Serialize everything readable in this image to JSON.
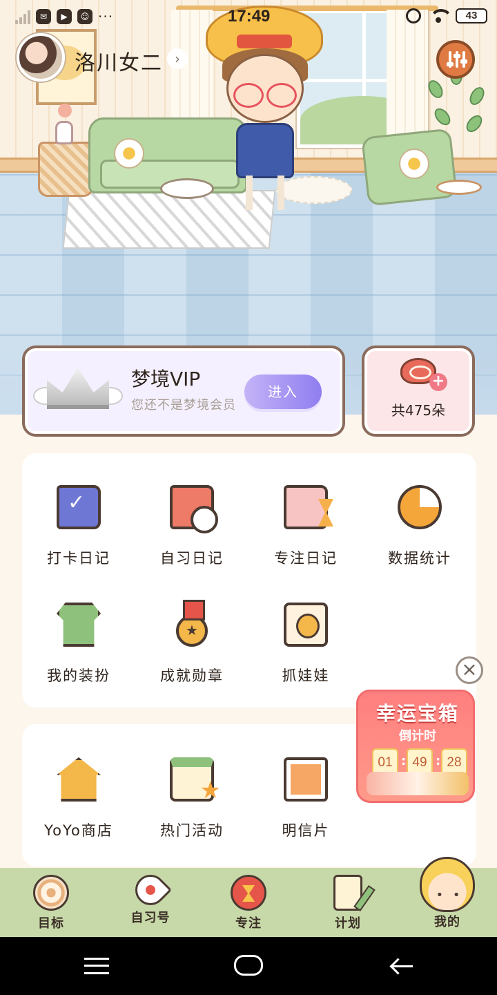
{
  "status_bar": {
    "time": "17:49",
    "battery": "43",
    "overflow": "···"
  },
  "profile": {
    "username": "洛川女二",
    "arrow": "›"
  },
  "vip": {
    "title": "梦境VIP",
    "subtitle": "您还不是梦境会员",
    "enter_label": "进入"
  },
  "flowers": {
    "count_label": "共475朵",
    "plus": "+"
  },
  "menu_grid": {
    "items": [
      {
        "label": "打卡日记",
        "icon": "checklist-book-icon"
      },
      {
        "label": "自习日记",
        "icon": "clock-book-icon"
      },
      {
        "label": "专注日记",
        "icon": "hourglass-book-icon"
      },
      {
        "label": "数据统计",
        "icon": "pie-chart-icon"
      },
      {
        "label": "我的装扮",
        "icon": "shirt-icon"
      },
      {
        "label": "成就勋章",
        "icon": "medal-icon"
      },
      {
        "label": "抓娃娃",
        "icon": "claw-machine-icon"
      }
    ]
  },
  "shop_grid": {
    "items": [
      {
        "label": "YoYo商店",
        "icon": "shop-house-icon"
      },
      {
        "label": "热门活动",
        "icon": "calendar-star-icon"
      },
      {
        "label": "明信片",
        "icon": "postcard-icon"
      }
    ]
  },
  "lucky_chest": {
    "title": "幸运宝箱",
    "subtitle": "倒计时",
    "hours": "01",
    "minutes": "49",
    "seconds": "28",
    "close": "×"
  },
  "tabs": [
    {
      "label": "目标",
      "icon": "target-icon"
    },
    {
      "label": "自习号",
      "icon": "rocket-icon"
    },
    {
      "label": "专注",
      "icon": "tomato-hourglass-icon"
    },
    {
      "label": "计划",
      "icon": "clipboard-pencil-icon"
    },
    {
      "label": "我的",
      "icon": "kid-avatar-icon"
    }
  ],
  "colors": {
    "tab_bar": "#c8d9a9",
    "vip_button": "#8f7ef0",
    "chest": "#ff7f7f",
    "page_bg": "#fdf6ec"
  }
}
